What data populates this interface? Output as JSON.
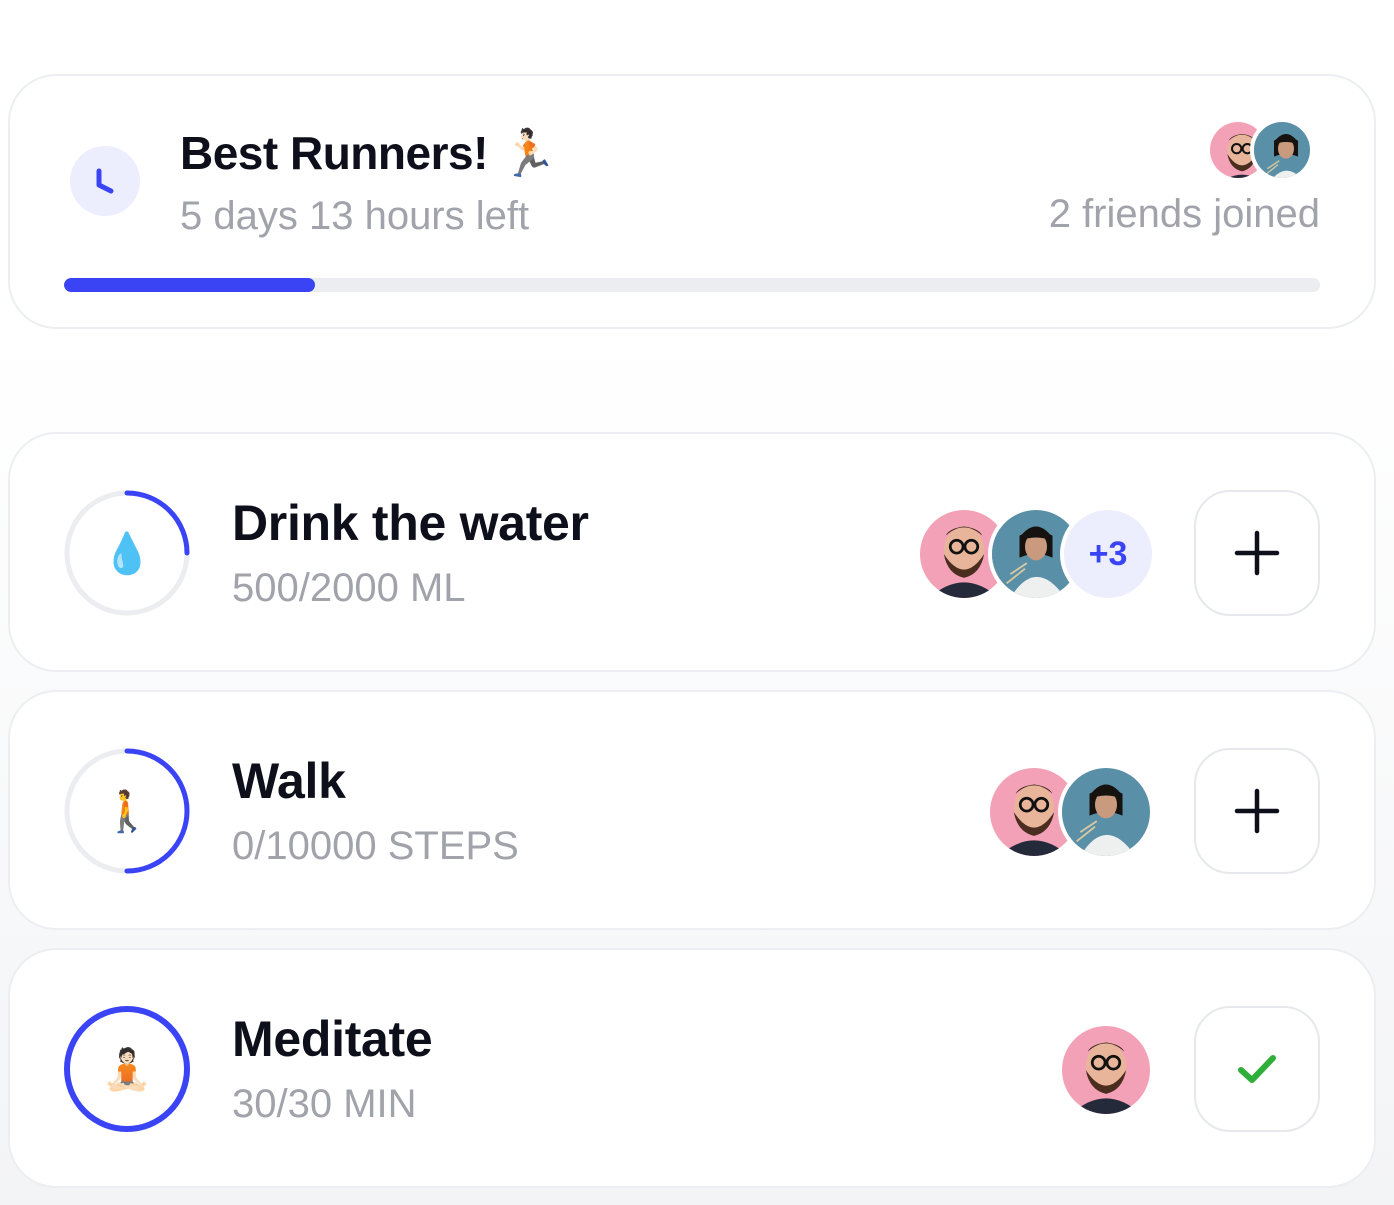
{
  "challenge": {
    "title": "Best Runners! 🏃🏻",
    "time_left": "5 days 13 hours left",
    "friends_joined": "2 friends joined",
    "progress": 0.2,
    "icon": "clock-icon"
  },
  "habits": [
    {
      "title": "Drink the water",
      "progress_text": "500/2000 ML",
      "emoji": "💧",
      "progress": 0.25,
      "extra_participants": "+3",
      "action": "add"
    },
    {
      "title": "Walk",
      "progress_text": "0/10000 STEPS",
      "emoji": "🚶",
      "progress": 0.5,
      "action": "add"
    },
    {
      "title": "Meditate",
      "progress_text": "30/30 MIN",
      "emoji": "🧘🏻",
      "progress": 1.0,
      "action": "done"
    }
  ],
  "colors": {
    "accent": "#3a44f5",
    "track": "#ebedf0",
    "muted_text": "#a1a3ab",
    "check": "#2fae3a"
  }
}
